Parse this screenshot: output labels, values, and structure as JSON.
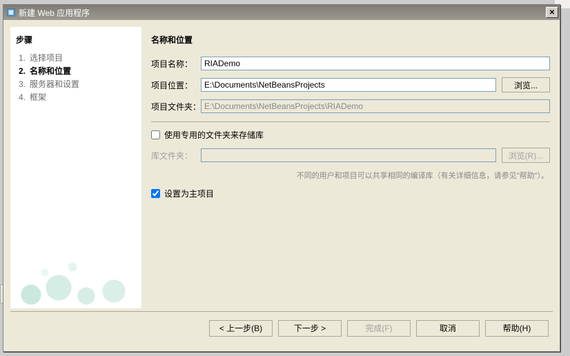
{
  "window": {
    "title": "新建 Web 应用程序"
  },
  "sidebar": {
    "heading": "步骤",
    "steps": [
      {
        "num": "1.",
        "label": "选择项目"
      },
      {
        "num": "2.",
        "label": "名称和位置"
      },
      {
        "num": "3.",
        "label": "服务器和设置"
      },
      {
        "num": "4.",
        "label": "框架"
      }
    ],
    "current_index": 1
  },
  "main": {
    "heading": "名称和位置",
    "project_name_label": "项目名称：",
    "project_name_value": "RIADemo",
    "project_location_label": "项目位置：",
    "project_location_value": "E:\\Documents\\NetBeansProjects",
    "browse_label": "浏览...",
    "project_folder_label": "项目文件夹：",
    "project_folder_value": "E:\\Documents\\NetBeansProjects\\RIADemo",
    "dedicated_folder_label": "使用专用的文件夹来存储库",
    "dedicated_folder_checked": false,
    "lib_folder_label": "库文件夹：",
    "lib_folder_value": "",
    "browse_r_label": "浏览(R)...",
    "hint_text": "不同的用户和项目可以共享相同的编译库（有关详细信息，请参见\"帮助\"）。",
    "set_main_label": "设置为主项目",
    "set_main_checked": true
  },
  "buttons": {
    "back": "< 上一步(B)",
    "next": "下一步 >",
    "finish": "完成(F)",
    "cancel": "取消",
    "help": "帮助(H)"
  }
}
